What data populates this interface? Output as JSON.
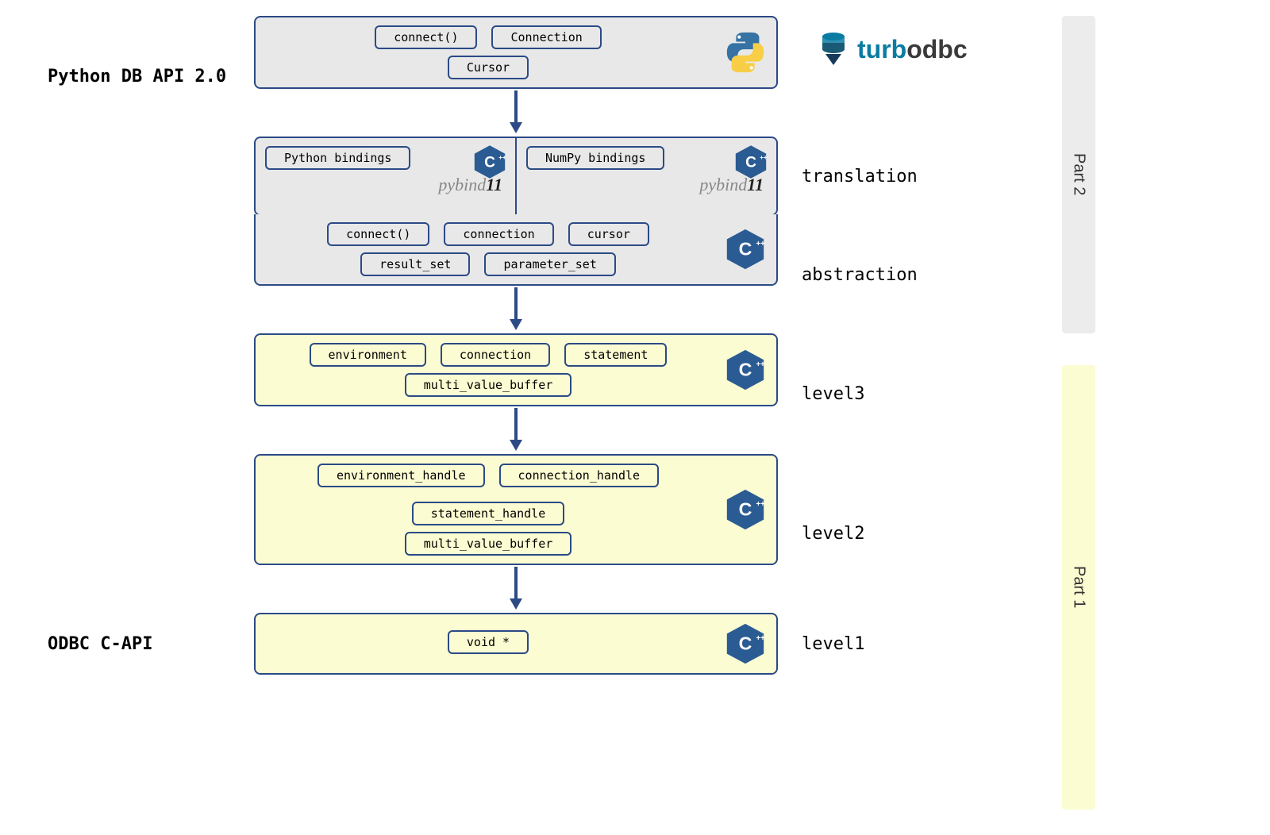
{
  "labels": {
    "python_dbapi": "Python DB API 2.0",
    "odbc_capi": "ODBC C-API",
    "translation": "translation",
    "abstraction": "abstraction",
    "level3": "level3",
    "level2": "level2",
    "level1": "level1",
    "part1": "Part 1",
    "part2": "Part 2"
  },
  "logos": {
    "turbodbc_turb": "turb",
    "turbodbc_odbc": "odbc",
    "pybind_py": "py",
    "pybind_bind": "bind",
    "pybind_num": "11"
  },
  "layers": {
    "dbapi": {
      "row1": [
        "connect()",
        "Connection"
      ],
      "row2": [
        "Cursor"
      ]
    },
    "bindings": {
      "left": "Python bindings",
      "right": "NumPy bindings"
    },
    "abstraction": {
      "row1": [
        "connect()",
        "connection",
        "cursor"
      ],
      "row2": [
        "result_set",
        "parameter_set"
      ]
    },
    "level3": {
      "row1": [
        "environment",
        "connection",
        "statement"
      ],
      "row2": [
        "multi_value_buffer"
      ]
    },
    "level2": {
      "row1": [
        "environment_handle",
        "connection_handle",
        "statement_handle"
      ],
      "row2": [
        "multi_value_buffer"
      ]
    },
    "level1": {
      "row1": [
        "void *"
      ]
    }
  },
  "colors": {
    "border": "#2b4a86",
    "grey_bg": "#e8e8e8",
    "yellow_bg": "#fcfcd2"
  }
}
